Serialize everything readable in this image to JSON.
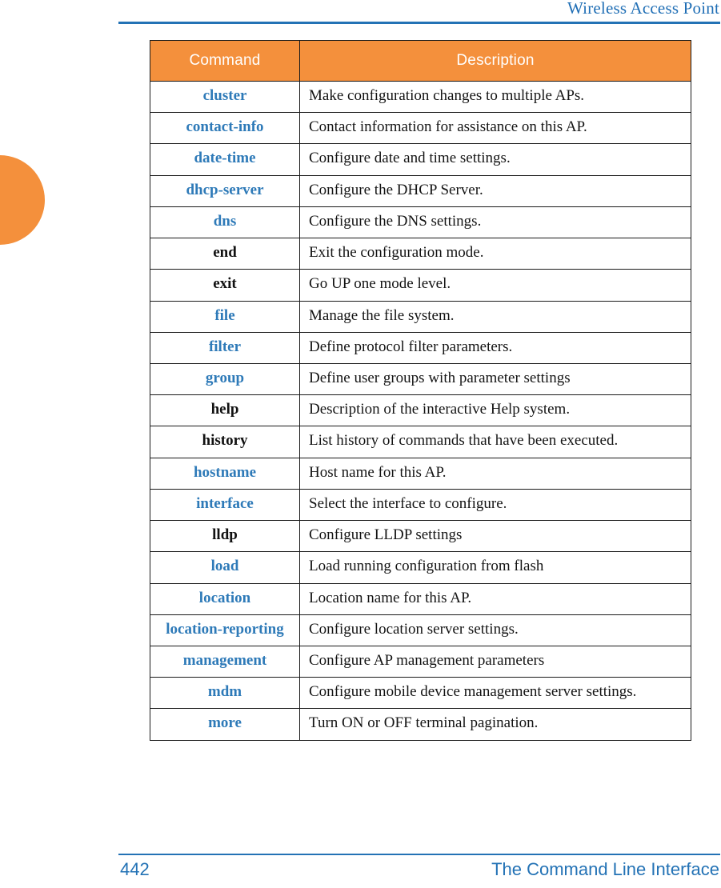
{
  "page": {
    "header_title": "Wireless Access Point",
    "footer_page_number": "442",
    "footer_section": "The Command Line Interface",
    "accent_orange": "#f4903c",
    "accent_blue": "#2372b5",
    "command_link_blue": "#2e7ab8"
  },
  "table": {
    "columns": [
      {
        "label": "Command"
      },
      {
        "label": "Description"
      }
    ],
    "rows": [
      {
        "command": "cluster",
        "description": "Make configuration changes to multiple APs.",
        "command_style": "link"
      },
      {
        "command": "contact-info",
        "description": "Contact information for assistance on this AP.",
        "command_style": "link"
      },
      {
        "command": "date-time",
        "description": "Configure date and time settings.",
        "command_style": "link"
      },
      {
        "command": "dhcp-server",
        "description": "Configure the DHCP Server.",
        "command_style": "link"
      },
      {
        "command": "dns",
        "description": "Configure the DNS settings.",
        "command_style": "link"
      },
      {
        "command": "end",
        "description": "Exit the configuration mode.",
        "command_style": "plain"
      },
      {
        "command": "exit",
        "description": "Go UP one mode level.",
        "command_style": "plain"
      },
      {
        "command": "file",
        "description": "Manage the file system.",
        "command_style": "link"
      },
      {
        "command": "filter",
        "description": "Define protocol filter parameters.",
        "command_style": "link"
      },
      {
        "command": "group",
        "description": "Define user groups with parameter settings",
        "command_style": "link"
      },
      {
        "command": "help",
        "description": "Description of the interactive Help system.",
        "command_style": "plain"
      },
      {
        "command": "history",
        "description": "List history of commands that have been executed.",
        "command_style": "plain"
      },
      {
        "command": "hostname",
        "description": "Host name for this AP.",
        "command_style": "link"
      },
      {
        "command": "interface",
        "description": "Select the interface to configure.",
        "command_style": "link"
      },
      {
        "command": "lldp",
        "description": "Configure LLDP settings",
        "command_style": "plain"
      },
      {
        "command": "load",
        "description": "Load running configuration from flash",
        "command_style": "link"
      },
      {
        "command": "location",
        "description": "Location name for this AP.",
        "command_style": "link"
      },
      {
        "command": "location-reporting",
        "description": "Configure location server settings.",
        "command_style": "link"
      },
      {
        "command": "management",
        "description": "Configure AP management parameters",
        "command_style": "link"
      },
      {
        "command": "mdm",
        "description": "Configure mobile device management server settings.",
        "command_style": "link"
      },
      {
        "command": "more",
        "description": "Turn ON or OFF terminal pagination.",
        "command_style": "link"
      }
    ]
  }
}
